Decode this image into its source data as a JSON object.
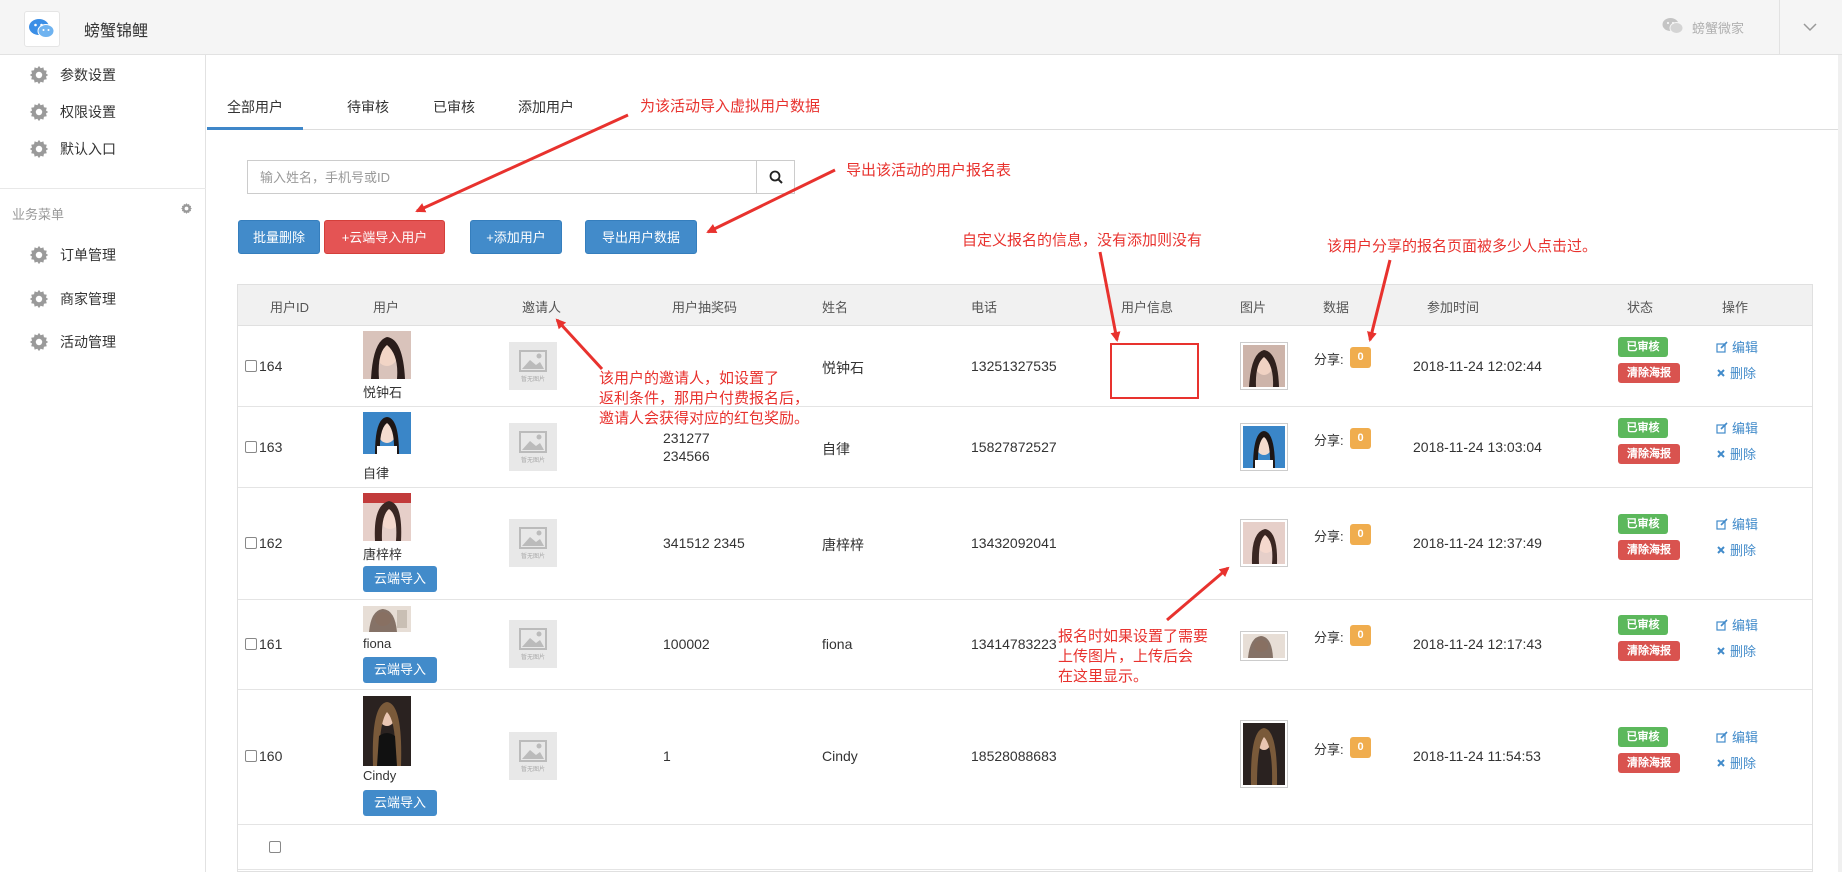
{
  "app": {
    "name": "螃蟹锦鲤",
    "brand": "螃蟹微家"
  },
  "sidebar": {
    "items": [
      {
        "label": "参数设置"
      },
      {
        "label": "权限设置"
      },
      {
        "label": "默认入口"
      }
    ],
    "group_label": "业务菜单",
    "group_items": [
      {
        "label": "订单管理"
      },
      {
        "label": "商家管理"
      },
      {
        "label": "活动管理"
      }
    ]
  },
  "tabs": [
    {
      "label": "全部用户",
      "active": true
    },
    {
      "label": "待审核"
    },
    {
      "label": "已审核"
    },
    {
      "label": "添加用户"
    }
  ],
  "search": {
    "placeholder": "输入姓名，手机号或ID",
    "value": ""
  },
  "actions": {
    "batch_delete": "批量删除",
    "cloud_import": "+云端导入用户",
    "add_user": "+添加用户",
    "export": "导出用户数据"
  },
  "table": {
    "headers": [
      "用户ID",
      "用户",
      "邀请人",
      "用户抽奖码",
      "姓名",
      "电话",
      "用户信息",
      "图片",
      "数据",
      "参加时间",
      "状态",
      "操作"
    ],
    "placeholder_caption": "暂无图片",
    "share_label": "分享:",
    "status_approved": "已审核",
    "clear_poster": "清除海报",
    "edit": "编辑",
    "delete": "删除",
    "import_label": "云端导入",
    "rows": [
      {
        "id": "164",
        "user": "悦钟石",
        "code_lines": [],
        "name": "悦钟石",
        "phone": "13251327535",
        "shares": "0",
        "time": "2018-11-24 12:02:44"
      },
      {
        "id": "163",
        "user": "自律",
        "code_lines": [
          "231277",
          "234566"
        ],
        "name": "自律",
        "phone": "15827872527",
        "shares": "0",
        "time": "2018-11-24 13:03:04"
      },
      {
        "id": "162",
        "user": "唐梓梓",
        "code_lines": [
          "341512 2345"
        ],
        "name": "唐梓梓",
        "phone": "13432092041",
        "shares": "0",
        "time": "2018-11-24 12:37:49"
      },
      {
        "id": "161",
        "user": "fiona",
        "code_lines": [
          "100002"
        ],
        "name": "fiona",
        "phone": "13414783223",
        "shares": "0",
        "time": "2018-11-24 12:17:43"
      },
      {
        "id": "160",
        "user": "Cindy",
        "code_lines": [
          "1"
        ],
        "name": "Cindy",
        "phone": "18528088683",
        "shares": "0",
        "time": "2018-11-24 11:54:53"
      }
    ]
  },
  "annotations": {
    "import_virtual": "为该活动导入虚拟用户数据",
    "export_sheet": "导出该活动的用户报名表",
    "custom_info": "自定义报名的信息，没有添加则没有",
    "share_clicks": "该用户分享的报名页面被多少人点击过。",
    "inviter_lines": [
      "该用户的邀请人，如设置了",
      "返利条件，那用户付费报名后，",
      "邀请人会获得对应的红包奖励。"
    ],
    "upload_lines": [
      "报名时如果设置了需要",
      "上传图片，上传后会",
      "在这里显示。"
    ]
  },
  "colors": {
    "primary": "#428bca",
    "danger": "#e45454",
    "success": "#5cb85c",
    "warning": "#f0ad4e",
    "annotation": "#e8322e"
  }
}
